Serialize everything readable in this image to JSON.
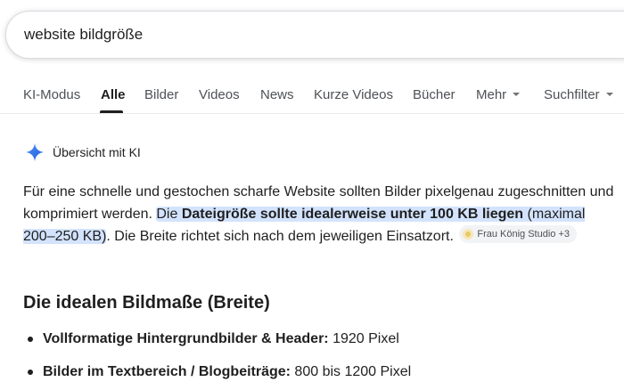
{
  "search": {
    "query": "website bildgröße"
  },
  "tabs": [
    {
      "label": "KI-Modus"
    },
    {
      "label": "Alle"
    },
    {
      "label": "Bilder"
    },
    {
      "label": "Videos"
    },
    {
      "label": "News"
    },
    {
      "label": "Kurze Videos"
    },
    {
      "label": "Bücher"
    },
    {
      "label": "Mehr"
    },
    {
      "label": "Suchfilter"
    }
  ],
  "ai_overview": {
    "header": "Übersicht mit KI",
    "icon": "sparkle-icon",
    "paragraph": {
      "part1": "Für eine schnelle und gestochen scharfe Website sollten Bilder pixelgenau zugeschnitten und komprimiert werden. ",
      "hl_pre": "Die ",
      "hl_bold": "Dateigröße sollte idealerweise unter 100 KB liegen",
      "hl_post": " (maximal 200–250 KB)",
      "part2": ". Die Breite richtet sich nach dem jeweiligen Einsatzort. ",
      "source_chip": "Frau König Studio +3"
    },
    "section_title": "Die idealen Bildmaße (Breite)",
    "list": [
      {
        "bold": "Vollformatige Hintergrundbilder & Header:",
        "text": " 1920 Pixel"
      },
      {
        "bold": "Bilder im Textbereich / Blogbeiträge:",
        "text": " 800 bis 1200 Pixel"
      }
    ]
  },
  "colors": {
    "highlight": "#d3e3fd",
    "sparkle": "#4285f4"
  }
}
